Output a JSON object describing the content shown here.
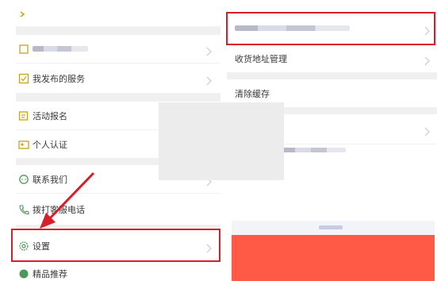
{
  "left_menu": {
    "items": [
      {
        "label": "我发布的服务"
      },
      {
        "label": "活动报名"
      },
      {
        "label": "个人认证"
      },
      {
        "label": "联系我们"
      },
      {
        "label": "拨打客服电话"
      },
      {
        "label": "设置"
      },
      {
        "label": "精品推荐"
      }
    ]
  },
  "right_menu": {
    "items": [
      {
        "label": "收货地址管理"
      },
      {
        "label": "清除缓存"
      }
    ]
  },
  "colors": {
    "highlight": "#d81e28",
    "icon": "#c6a51a",
    "banner": "#ff5a45",
    "divider": "#f0f0f0"
  }
}
